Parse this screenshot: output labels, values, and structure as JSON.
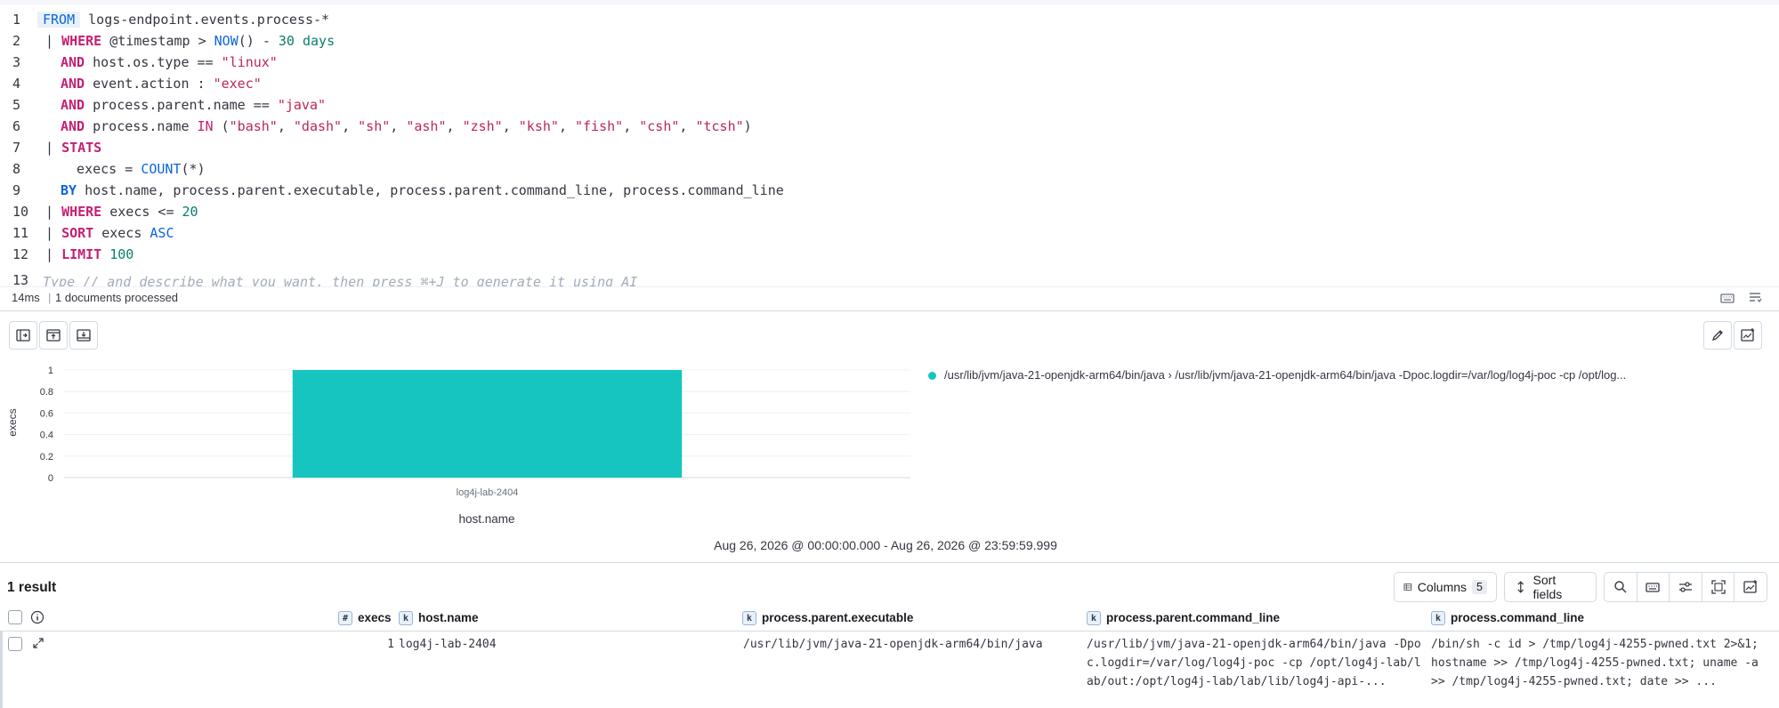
{
  "editor": {
    "lines": [
      {
        "n": "1"
      },
      {
        "n": "2"
      },
      {
        "n": "3"
      },
      {
        "n": "4"
      },
      {
        "n": "5"
      },
      {
        "n": "6"
      },
      {
        "n": "7"
      },
      {
        "n": "8"
      },
      {
        "n": "9"
      },
      {
        "n": "10"
      },
      {
        "n": "11"
      },
      {
        "n": "12"
      },
      {
        "n": "13"
      }
    ],
    "tokens": {
      "from": "FROM",
      "from_src": " logs-endpoint.events.process-*",
      "pipe": "| ",
      "where": "WHERE",
      "l2_rest_a": " @timestamp > ",
      "now": "NOW",
      "l2_rest_b": "() - ",
      "l2_num": "30 days",
      "and": "AND",
      "l3_rest": " host.os.type == ",
      "l3_str": "\"linux\"",
      "l4_rest": " event.action : ",
      "l4_str": "\"exec\"",
      "l5_rest": " process.parent.name == ",
      "l5_str": "\"java\"",
      "l6_rest": " process.name ",
      "in": "IN",
      "l6_open": " (",
      "l6_list": [
        "\"bash\"",
        "\"dash\"",
        "\"sh\"",
        "\"ash\"",
        "\"zsh\"",
        "\"ksh\"",
        "\"fish\"",
        "\"csh\"",
        "\"tcsh\""
      ],
      "l6_close": ")",
      "stats": "STATS",
      "l8_rest": "  execs = ",
      "count": "COUNT",
      "l8_tail": "(*)",
      "by": "BY",
      "l9_rest": " host.name, process.parent.executable, process.parent.command_line, process.command_line",
      "l10_rest": " execs <= ",
      "l10_num": "20",
      "sort": "SORT",
      "l11_rest": " execs ",
      "asc": "ASC",
      "limit": "LIMIT",
      "l12_num": " 100",
      "placeholder": "Type // and describe what you want, then press ⌘+J to generate it using AI"
    }
  },
  "footer": {
    "time": "14ms",
    "docs": "1 documents processed"
  },
  "chart_data": {
    "type": "bar",
    "categories": [
      "log4j-lab-2404"
    ],
    "series": [
      {
        "name": "/usr/lib/jvm/java-21-openjdk-arm64/bin/java › /usr/lib/jvm/java-21-openjdk-arm64/bin/java -Dpoc.logdir=/var/log/log4j-poc -cp /opt/log...",
        "values": [
          1
        ],
        "color": "#16c5c0"
      }
    ],
    "xlabel": "host.name",
    "ylabel": "execs",
    "ylim": [
      0,
      1
    ],
    "yticks": [
      "0",
      "0.2",
      "0.4",
      "0.6",
      "0.8",
      "1"
    ],
    "grid": true,
    "legend": "right"
  },
  "timerange": "Aug 26, 2026 @ 00:00:00.000 - Aug 26, 2026 @ 23:59:59.999",
  "results": {
    "count_label": "1 result",
    "columns_label": "Columns",
    "columns_count": "5",
    "sort_label": "Sort fields",
    "headers": [
      {
        "type": "#",
        "name": "execs"
      },
      {
        "type": "k",
        "name": "host.name"
      },
      {
        "type": "k",
        "name": "process.parent.executable"
      },
      {
        "type": "k",
        "name": "process.parent.command_line"
      },
      {
        "type": "k",
        "name": "process.command_line"
      }
    ],
    "rows": [
      {
        "execs": "1",
        "host_name": "log4j-lab-2404",
        "parent_executable": "/usr/lib/jvm/java-21-openjdk-arm64/bin/java",
        "parent_command_line": "/usr/lib/jvm/java-21-openjdk-arm64/bin/java -Dpoc.logdir=/var/log/log4j-poc -cp /opt/log4j-lab/lab/out:/opt/log4j-lab/lab/lib/log4j-api-...",
        "command_line": "/bin/sh -c id > /tmp/log4j-4255-pwned.txt 2>&1; hostname >> /tmp/log4j-4255-pwned.txt; uname -a >> /tmp/log4j-4255-pwned.txt; date >> ..."
      }
    ]
  }
}
